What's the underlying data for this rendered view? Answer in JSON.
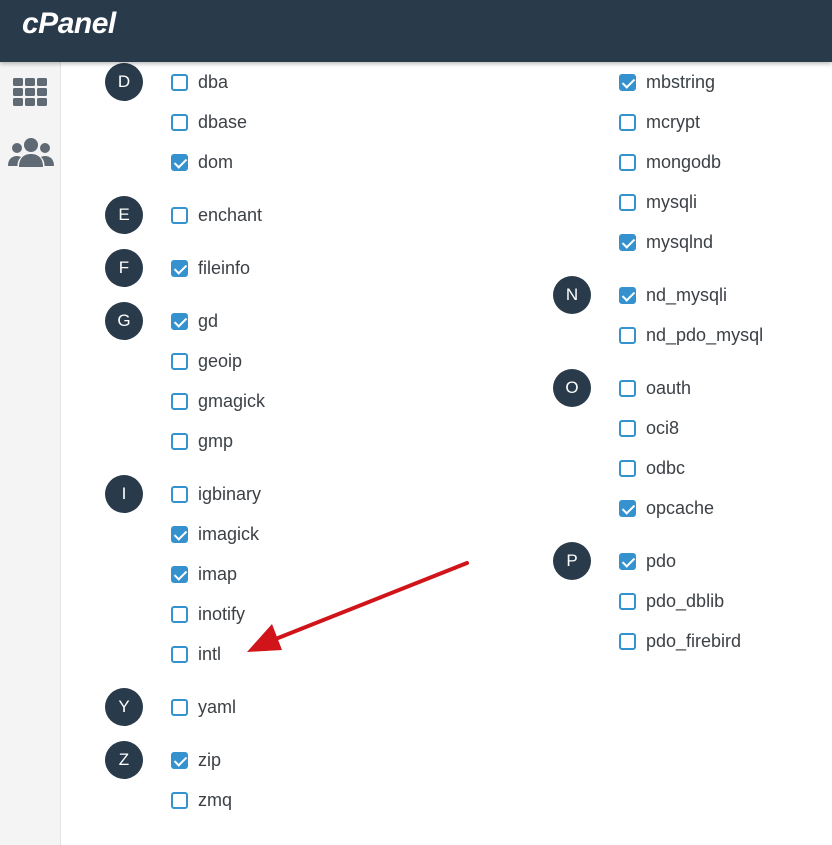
{
  "app": {
    "logo_text": "cPanel"
  },
  "sidebar": {
    "items": [
      {
        "name": "grid-menu-icon"
      },
      {
        "name": "users-icon"
      }
    ]
  },
  "colors": {
    "topbar": "#293a4a",
    "accent": "#3592cf",
    "badge": "#293a4a",
    "arrow": "#d0141a"
  },
  "extensions": {
    "left": [
      {
        "letter": "D",
        "items": [
          {
            "label": "dba",
            "checked": false
          },
          {
            "label": "dbase",
            "checked": false
          },
          {
            "label": "dom",
            "checked": true
          }
        ]
      },
      {
        "letter": "E",
        "items": [
          {
            "label": "enchant",
            "checked": false
          }
        ]
      },
      {
        "letter": "F",
        "items": [
          {
            "label": "fileinfo",
            "checked": true
          }
        ]
      },
      {
        "letter": "G",
        "items": [
          {
            "label": "gd",
            "checked": true
          },
          {
            "label": "geoip",
            "checked": false
          },
          {
            "label": "gmagick",
            "checked": false
          },
          {
            "label": "gmp",
            "checked": false
          }
        ]
      },
      {
        "letter": "I",
        "items": [
          {
            "label": "igbinary",
            "checked": false
          },
          {
            "label": "imagick",
            "checked": true
          },
          {
            "label": "imap",
            "checked": true
          },
          {
            "label": "inotify",
            "checked": false
          },
          {
            "label": "intl",
            "checked": false
          }
        ]
      },
      {
        "letter": "Y",
        "items": [
          {
            "label": "yaml",
            "checked": false
          }
        ]
      },
      {
        "letter": "Z",
        "items": [
          {
            "label": "zip",
            "checked": true
          },
          {
            "label": "zmq",
            "checked": false
          }
        ]
      }
    ],
    "right": [
      {
        "letter": "",
        "items": [
          {
            "label": "mbstring",
            "checked": true
          },
          {
            "label": "mcrypt",
            "checked": false
          },
          {
            "label": "mongodb",
            "checked": false
          },
          {
            "label": "mysqli",
            "checked": false
          },
          {
            "label": "mysqlnd",
            "checked": true
          }
        ]
      },
      {
        "letter": "N",
        "items": [
          {
            "label": "nd_mysqli",
            "checked": true
          },
          {
            "label": "nd_pdo_mysql",
            "checked": false
          }
        ]
      },
      {
        "letter": "O",
        "items": [
          {
            "label": "oauth",
            "checked": false
          },
          {
            "label": "oci8",
            "checked": false
          },
          {
            "label": "odbc",
            "checked": false
          },
          {
            "label": "opcache",
            "checked": true
          }
        ]
      },
      {
        "letter": "P",
        "items": [
          {
            "label": "pdo",
            "checked": true
          },
          {
            "label": "pdo_dblib",
            "checked": false
          },
          {
            "label": "pdo_firebird",
            "checked": false
          }
        ]
      }
    ]
  }
}
